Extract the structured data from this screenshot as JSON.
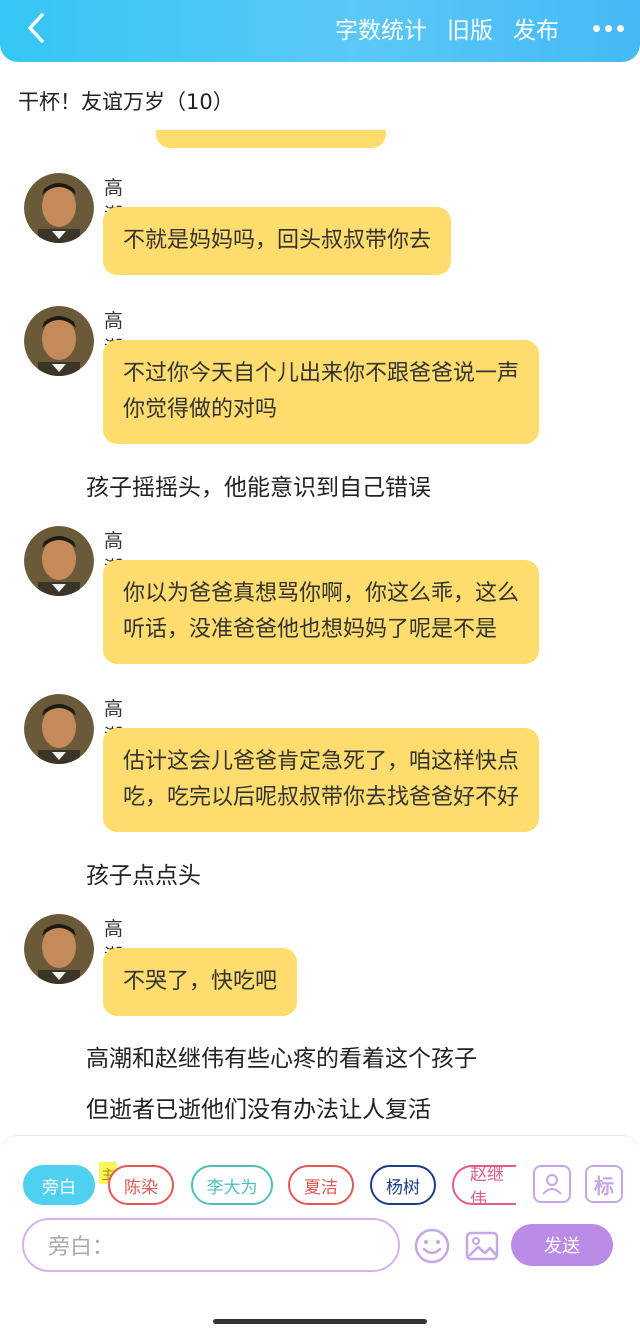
{
  "topbar": {
    "back_icon": "chevron-left-icon",
    "word_count_label": "字数统计",
    "old_version_label": "旧版",
    "publish_label": "发布",
    "more_icon": "more-dots-icon"
  },
  "group": {
    "title": "干杯！友谊万岁（10）"
  },
  "messages": [
    {
      "sender": "高潮",
      "lines": [
        "不就是妈妈吗，回头叔叔带你去"
      ]
    },
    {
      "sender": "高潮",
      "lines": [
        "不过你今天自个儿出来你不跟爸爸说一声",
        "你觉得做的对吗"
      ]
    },
    {
      "narration": "孩子摇摇头，他能意识到自己错误"
    },
    {
      "sender": "高潮",
      "lines": [
        "你以为爸爸真想骂你啊，你这么乖，这么",
        "听话，没准爸爸他也想妈妈了呢是不是"
      ]
    },
    {
      "sender": "高潮",
      "lines": [
        "估计这会儿爸爸肯定急死了，咱这样快点",
        "吃，吃完以后呢叔叔带你去找爸爸好不好"
      ]
    },
    {
      "narration": "孩子点点头"
    },
    {
      "sender": "高潮",
      "lines": [
        "不哭了，快吃吧"
      ]
    },
    {
      "narration": "高潮和赵继伟有些心疼的看着这个孩子"
    },
    {
      "narration": "但逝者已逝他们没有办法让人复活"
    }
  ],
  "composer": {
    "roles": [
      "旁白",
      "陈染",
      "李大为",
      "夏洁",
      "杨树",
      "赵继伟"
    ],
    "host_tag": "主",
    "role_icon": "person-card-icon",
    "mark_label": "标",
    "input_placeholder": "旁白：",
    "emoji_icon": "emoji-icon",
    "image_icon": "image-icon",
    "send_label": "发送"
  },
  "colors": {
    "accent": "#45c0f4",
    "bubble": "#fedc6e",
    "send": "#bb8ce6"
  }
}
